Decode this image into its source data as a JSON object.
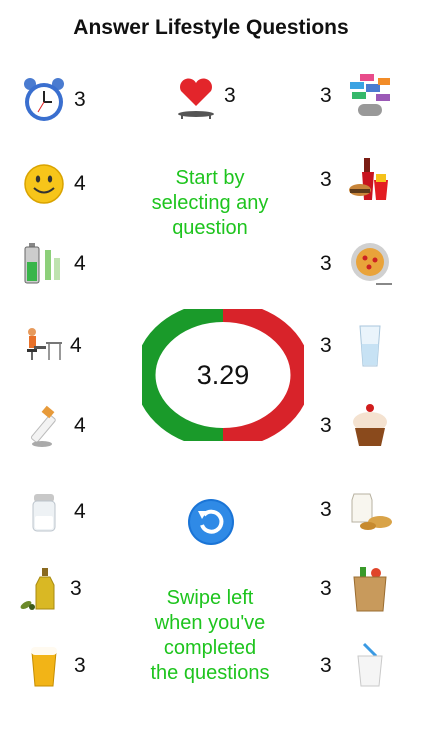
{
  "title": "Answer Lifestyle Questions",
  "questions": {
    "left": [
      {
        "icon": "alarm-clock-icon",
        "value": "3"
      },
      {
        "icon": "smiley-face-icon",
        "value": "4"
      },
      {
        "icon": "battery-icon",
        "value": "4"
      },
      {
        "icon": "desk-worker-icon",
        "value": "4"
      },
      {
        "icon": "cigarette-icon",
        "value": "4"
      },
      {
        "icon": "salt-shaker-icon",
        "value": "4"
      },
      {
        "icon": "olive-oil-icon",
        "value": "3"
      },
      {
        "icon": "beer-glass-icon",
        "value": "3"
      }
    ],
    "center": {
      "icon": "heart-trampoline-icon",
      "value": "3"
    },
    "right": [
      {
        "icon": "social-media-icon",
        "value": "3"
      },
      {
        "icon": "fast-food-icon",
        "value": "3"
      },
      {
        "icon": "pizza-plate-icon",
        "value": "3"
      },
      {
        "icon": "water-glass-icon",
        "value": "3"
      },
      {
        "icon": "cupcake-icon",
        "value": "3"
      },
      {
        "icon": "milk-bread-icon",
        "value": "3"
      },
      {
        "icon": "grocery-bag-icon",
        "value": "3"
      },
      {
        "icon": "milk-glass-icon",
        "value": "3"
      }
    ]
  },
  "prompt_start": [
    "Start by",
    "selecting any",
    "question"
  ],
  "score": "3.29",
  "refresh_icon": "refresh-icon",
  "prompt_swipe": [
    "Swipe left",
    "when you've",
    "completed",
    "the questions"
  ],
  "colors": {
    "green": "#1ec41e",
    "ring_green": "#1a9a2a",
    "ring_red": "#d8232a"
  }
}
